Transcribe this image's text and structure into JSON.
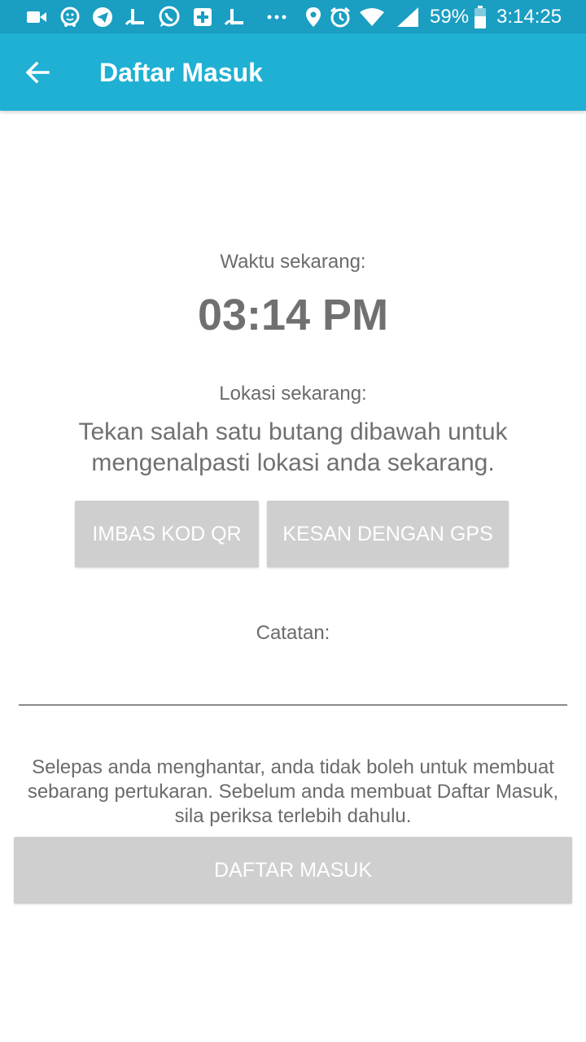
{
  "status_bar": {
    "battery": "59%",
    "time": "3:14:25",
    "left_icons": [
      "video-icon",
      "waze-icon",
      "telegram-icon",
      "app-l-icon",
      "whatsapp-icon",
      "hospital-icon",
      "app-l-icon",
      "more-icon"
    ],
    "right_icons": [
      "location-icon",
      "alarm-icon",
      "wifi-icon",
      "signal-icon",
      "battery-icon"
    ]
  },
  "app_bar": {
    "title": "Daftar Masuk",
    "back_icon": "arrow-left-icon",
    "color": "#1fb0d4"
  },
  "main": {
    "time_label": "Waktu sekarang:",
    "time_value": "03:14 PM",
    "location_label": "Lokasi sekarang:",
    "instruction_line1": "Tekan salah satu butang dibawah untuk",
    "instruction_line2": "mengenalpasti lokasi anda sekarang.",
    "scan_qr_label": "IMBAS KOD QR",
    "gps_label": "KESAN DENGAN GPS",
    "note_label": "Catatan:",
    "note_value": "",
    "notice_line1": "Selepas anda menghantar, anda tidak boleh untuk membuat",
    "notice_line2": "sebarang pertukaran. Sebelum anda membuat Daftar Masuk,",
    "notice_line3": "sila periksa terlebih dahulu.",
    "submit_label": "DAFTAR MASUK"
  }
}
